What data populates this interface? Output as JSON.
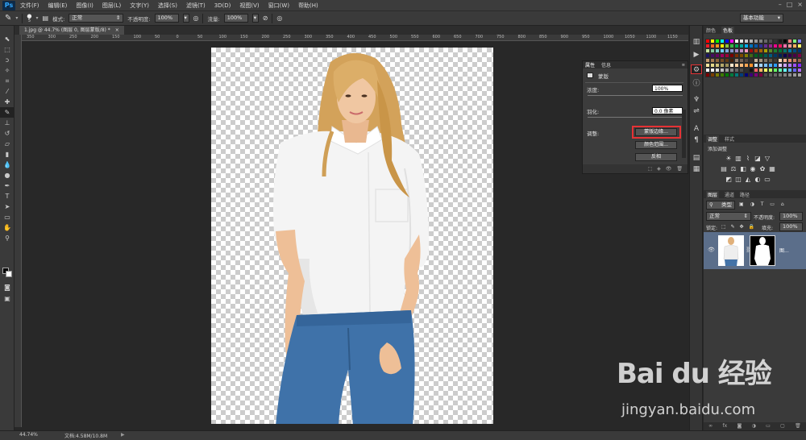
{
  "menubar": {
    "logo": "Ps",
    "items": [
      "文件(F)",
      "编辑(E)",
      "图像(I)",
      "图层(L)",
      "文字(Y)",
      "选择(S)",
      "滤镜(T)",
      "3D(D)",
      "视图(V)",
      "窗口(W)",
      "帮助(H)"
    ]
  },
  "options": {
    "brush_size": "5",
    "mode_label": "模式:",
    "mode_value": "正常",
    "opacity_label": "不透明度:",
    "opacity_value": "100%",
    "flow_label": "流量:",
    "flow_value": "100%",
    "workspace": "基本功能"
  },
  "document": {
    "tab_title": "1.jpg @ 44.7% (图层 0, 图层蒙版/8) *",
    "ruler_ticks": [
      "350",
      "300",
      "250",
      "200",
      "150",
      "100",
      "50",
      "0",
      "50",
      "100",
      "150",
      "200",
      "250",
      "300",
      "350",
      "400",
      "450",
      "500",
      "550",
      "600",
      "650",
      "700",
      "750",
      "800",
      "850",
      "900",
      "950",
      "1000",
      "1050",
      "1100",
      "1150"
    ]
  },
  "properties_panel": {
    "tabs": [
      "属性",
      "信息"
    ],
    "section_title": "蒙版",
    "density_label": "浓度:",
    "density_value": "100%",
    "feather_label": "羽化:",
    "feather_value": "0.0 像素",
    "adjust_label": "调整:",
    "buttons": {
      "mask_edge": "蒙版边缘...",
      "color_range": "颜色范围...",
      "invert": "反相"
    }
  },
  "swatches_panel": {
    "tabs": [
      "颜色",
      "色板"
    ],
    "active_tab": "色板"
  },
  "adjustments_panel": {
    "tabs": [
      "调整",
      "样式"
    ],
    "title": "添加调整"
  },
  "layers_panel": {
    "tabs": [
      "图层",
      "通道",
      "路径"
    ],
    "filter_label": "类型",
    "blend_mode": "正常",
    "opacity_label": "不透明度:",
    "opacity_value": "100%",
    "lock_label": "锁定:",
    "fill_label": "填充:",
    "fill_value": "100%",
    "layer_name": "图..."
  },
  "statusbar": {
    "zoom": "44.74%",
    "doc_info": "文档:4.58M/10.8M"
  },
  "watermark": {
    "logo": "Bai du 经验",
    "url": "jingyan.baidu.com"
  },
  "colors": {
    "highlight": "#e53235",
    "layer_selected": "#5b6e8a",
    "swatch_palette": [
      "#ff0000",
      "#ffff00",
      "#00ff00",
      "#00ffff",
      "#0000ff",
      "#ff00ff",
      "#ffffff",
      "#e6e6e6",
      "#cccccc",
      "#b3b3b3",
      "#999999",
      "#808080",
      "#666666",
      "#4d4d4d",
      "#333333",
      "#1a1a1a",
      "#000000",
      "#ff8080",
      "#80ff80",
      "#8080ff",
      "#ed1c24",
      "#f26522",
      "#f7941d",
      "#fff200",
      "#8dc63f",
      "#39b54a",
      "#00a651",
      "#00a99d",
      "#00aeef",
      "#0072bc",
      "#0054a6",
      "#2e3192",
      "#662d91",
      "#92278f",
      "#ec008c",
      "#ed145b",
      "#f06eaa",
      "#f5989d",
      "#fbaf5d",
      "#fff568",
      "#c4df9b",
      "#82ca9c",
      "#7accc8",
      "#6dcff6",
      "#7da7d9",
      "#8393ca",
      "#a187be",
      "#bd8cbf",
      "#f49ac1",
      "#9e0b0f",
      "#a0410d",
      "#a36209",
      "#aba000",
      "#598527",
      "#1a7b30",
      "#007236",
      "#00746b",
      "#0076a3",
      "#004a80",
      "#003471",
      "#1b1464",
      "#440e62",
      "#630460",
      "#9e005d",
      "#9e0039",
      "#790000",
      "#7b2e00",
      "#7d4900",
      "#827b00",
      "#406618",
      "#005e20",
      "#005826",
      "#005952",
      "#005b7f",
      "#003663",
      "#002157",
      "#0d004c",
      "#32004b",
      "#4b0049",
      "#7b0046",
      "#c69c6d",
      "#a67c52",
      "#8c6239",
      "#754c24",
      "#603913",
      "#42210b",
      "#998675",
      "#736357",
      "#534741",
      "#362f2d",
      "#c7b299",
      "#a39480",
      "#7f7263",
      "#605848",
      "#403a33",
      "#fcd5b5",
      "#f9b294",
      "#e68a6e",
      "#c97b63",
      "#a0614c",
      "#f6e49c",
      "#e4d98a",
      "#cfc27b",
      "#b4a96b",
      "#998e58",
      "#ffe6cc",
      "#ffd1a3",
      "#ffbb7a",
      "#ffa552",
      "#ff8f29",
      "#c8e6ff",
      "#a3d3ff",
      "#7ac1ff",
      "#52aeff",
      "#299cff",
      "#e0c8ff",
      "#c9a3ff",
      "#b27aff",
      "#9b52ff",
      "#8429ff",
      "#ffffff",
      "#f2f2f2",
      "#e0e0e0",
      "#c2c2c2",
      "#a3a3a3",
      "#858585",
      "#666666",
      "#4a4a4a",
      "#2e2e2e",
      "#121212",
      "#ff6666",
      "#ffb366",
      "#ffff66",
      "#b3ff66",
      "#66ff66",
      "#66ffb3",
      "#66ffff",
      "#66b3ff",
      "#6666ff",
      "#b366ff",
      "#7a0000",
      "#7a3d00",
      "#7a7a00",
      "#3d7a00",
      "#007a00",
      "#007a3d",
      "#007a7a",
      "#003d7a",
      "#00007a",
      "#3d007a",
      "#7a007a",
      "#7a003d",
      "#4d4d4d",
      "#595959",
      "#666666",
      "#737373",
      "#808080",
      "#8c8c8c",
      "#999999",
      "#a6a6a6"
    ]
  }
}
